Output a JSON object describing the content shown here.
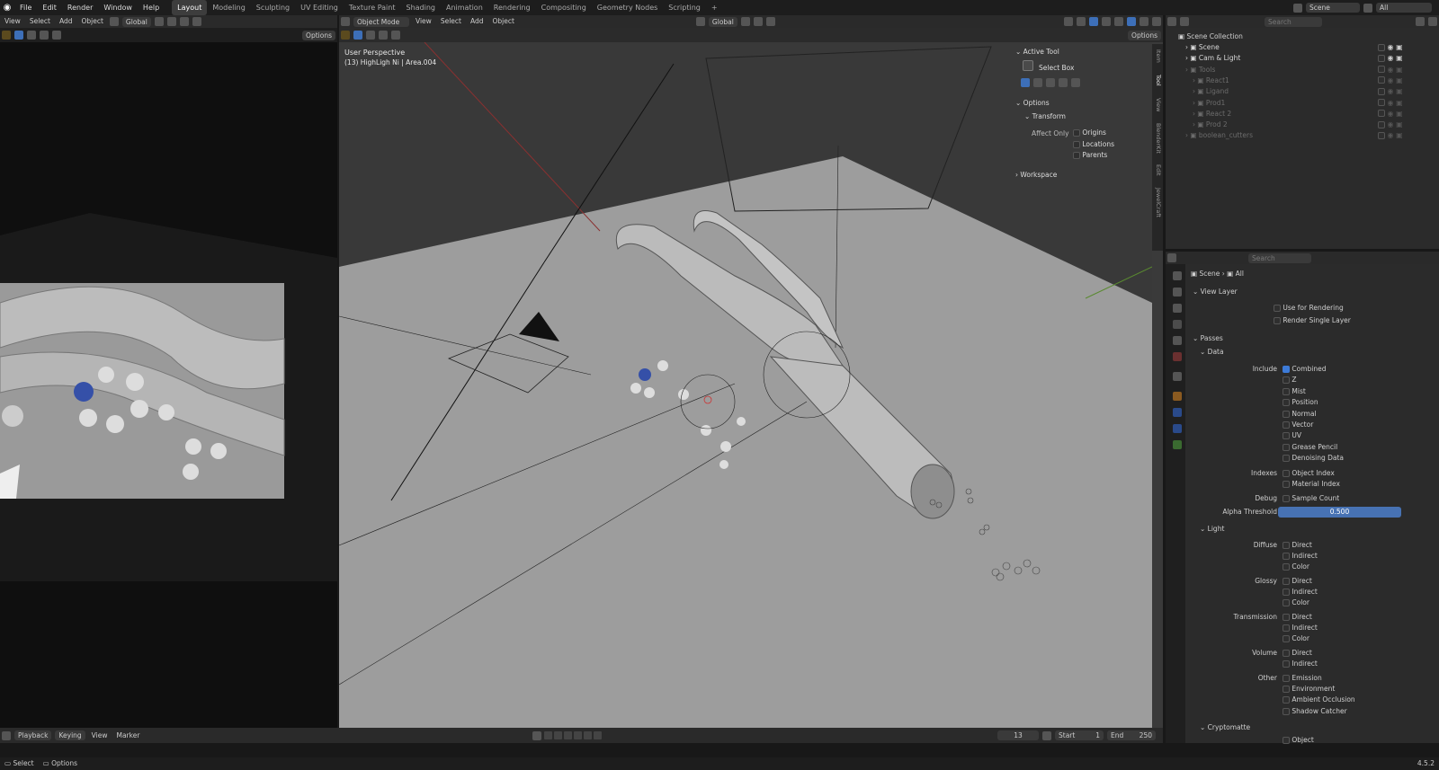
{
  "app": {
    "menu": [
      "File",
      "Edit",
      "Render",
      "Window",
      "Help"
    ],
    "workspaces": [
      "Layout",
      "Modeling",
      "Sculpting",
      "UV Editing",
      "Texture Paint",
      "Shading",
      "Animation",
      "Rendering",
      "Compositing",
      "Geometry Nodes",
      "Scripting"
    ],
    "active_workspace": "Layout",
    "scene_name": "Scene",
    "view_layer": "All",
    "version": "4.5.2"
  },
  "left_editor": {
    "menu": [
      "View",
      "Select",
      "Add",
      "Object"
    ],
    "orientation": "Global",
    "options_label": "Options"
  },
  "viewport": {
    "mode": "Object Mode",
    "menu": [
      "View",
      "Select",
      "Add",
      "Object"
    ],
    "orientation": "Global",
    "options_label": "Options",
    "overlay_title": "User Perspective",
    "overlay_subtitle": "(13) HighLigh Ni | Area.004",
    "sidebar_tabs": [
      "Item",
      "Tool",
      "View",
      "BlenderKit",
      "Edit",
      "JewelCraft"
    ],
    "tool_panel": {
      "active_tool_header": "Active Tool",
      "tool_name": "Select Box",
      "options_header": "Options",
      "transform_header": "Transform",
      "affect_only_label": "Affect Only",
      "affect_items": [
        "Origins",
        "Locations",
        "Parents"
      ],
      "workspace_header": "Workspace"
    }
  },
  "outliner": {
    "search_placeholder": "Search",
    "root": "Scene Collection",
    "items": [
      {
        "name": "Scene",
        "indent": 1
      },
      {
        "name": "Cam & Light",
        "indent": 1
      },
      {
        "name": "Tools",
        "indent": 1
      },
      {
        "name": "React1",
        "indent": 2
      },
      {
        "name": "Ligand",
        "indent": 2
      },
      {
        "name": "Prod1",
        "indent": 2
      },
      {
        "name": "React 2",
        "indent": 2
      },
      {
        "name": "Prod 2",
        "indent": 2
      },
      {
        "name": "boolean_cutters",
        "indent": 1
      }
    ]
  },
  "properties": {
    "search_placeholder": "Search",
    "breadcrumb": [
      "Scene",
      "All"
    ],
    "view_layer_header": "View Layer",
    "use_for_rendering": "Use for Rendering",
    "render_single_layer": "Render Single Layer",
    "passes_header": "Passes",
    "data_header": "Data",
    "include_label": "Include",
    "include_items": [
      {
        "label": "Combined",
        "checked": true
      },
      {
        "label": "Z",
        "checked": false
      },
      {
        "label": "Mist",
        "checked": false
      },
      {
        "label": "Position",
        "checked": false
      },
      {
        "label": "Normal",
        "checked": false
      },
      {
        "label": "Vector",
        "checked": false
      },
      {
        "label": "UV",
        "checked": false
      },
      {
        "label": "Grease Pencil",
        "checked": false
      },
      {
        "label": "Denoising Data",
        "checked": false
      }
    ],
    "indexes_label": "Indexes",
    "indexes_items": [
      "Object Index",
      "Material Index"
    ],
    "debug_label": "Debug",
    "debug_items": [
      "Sample Count"
    ],
    "alpha_label": "Alpha Threshold",
    "alpha_value": "0.500",
    "light_header": "Light",
    "diffuse_label": "Diffuse",
    "glossy_label": "Glossy",
    "transmission_label": "Transmission",
    "volume_label": "Volume",
    "other_label": "Other",
    "dic": [
      "Direct",
      "Indirect",
      "Color"
    ],
    "volume_items": [
      "Direct",
      "Indirect"
    ],
    "other_items": [
      "Emission",
      "Environment",
      "Ambient Occlusion",
      "Shadow Catcher"
    ],
    "cryptomatte_header": "Cryptomatte",
    "crypto_first": "Object"
  },
  "timeline": {
    "menu": [
      "Playback",
      "Keying",
      "View",
      "Marker"
    ],
    "current_frame": "13",
    "start_label": "Start",
    "start_value": "1",
    "end_label": "End",
    "end_value": "250"
  },
  "statusbar": {
    "items": [
      "Select",
      "Options"
    ]
  },
  "colors": {
    "accent": "#4772b3",
    "bg": "#181818",
    "header": "#2a2a2a"
  }
}
